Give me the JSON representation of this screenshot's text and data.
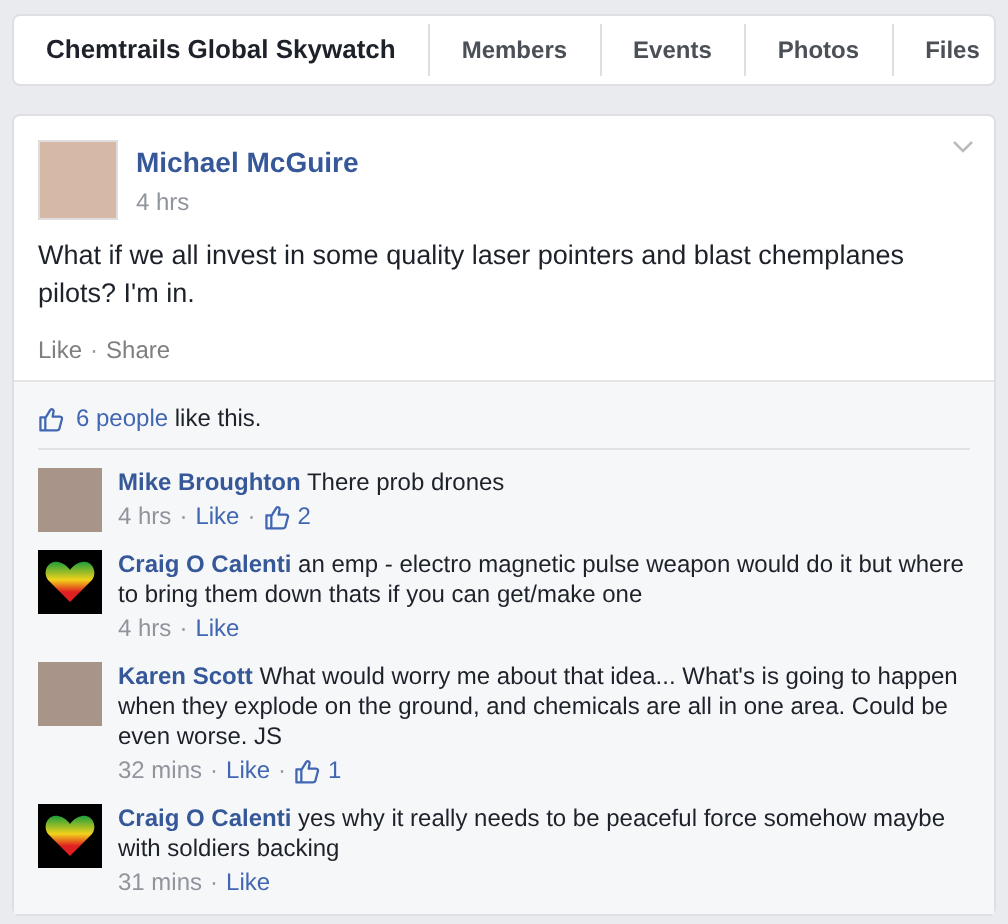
{
  "group_nav": {
    "title": "Chemtrails Global Skywatch",
    "tabs": [
      "Members",
      "Events",
      "Photos",
      "Files"
    ]
  },
  "separator": "·",
  "post": {
    "author": "Michael McGuire",
    "time": "4 hrs",
    "text": "What if we all invest in some quality laser pointers and blast chemplanes pilots? I'm in.",
    "actions": [
      "Like",
      "Share"
    ],
    "likes": {
      "count": "6 people",
      "rest": "like this."
    },
    "comments": [
      {
        "author": "Mike Broughton",
        "text": "There prob drones",
        "time": "4 hrs",
        "action": "Like",
        "likes": "2",
        "kind": "photo"
      },
      {
        "author": "Craig O Calenti",
        "text": "an emp - electro magnetic pulse weapon would do it but where to bring them down thats if you can get/make one",
        "time": "4 hrs",
        "action": "Like",
        "kind": "heart"
      },
      {
        "author": "Karen Scott",
        "text": "What would worry me about that idea... What's is going to happen when they explode on the ground, and chemicals are all in one area. Could be even worse. JS",
        "time": "32 mins",
        "action": "Like",
        "likes": "1",
        "kind": "photo"
      },
      {
        "author": "Craig O Calenti",
        "text": "yes why it really needs to be peaceful force somehow maybe with soldiers backing",
        "time": "31 mins",
        "action": "Like",
        "kind": "heart"
      }
    ]
  }
}
